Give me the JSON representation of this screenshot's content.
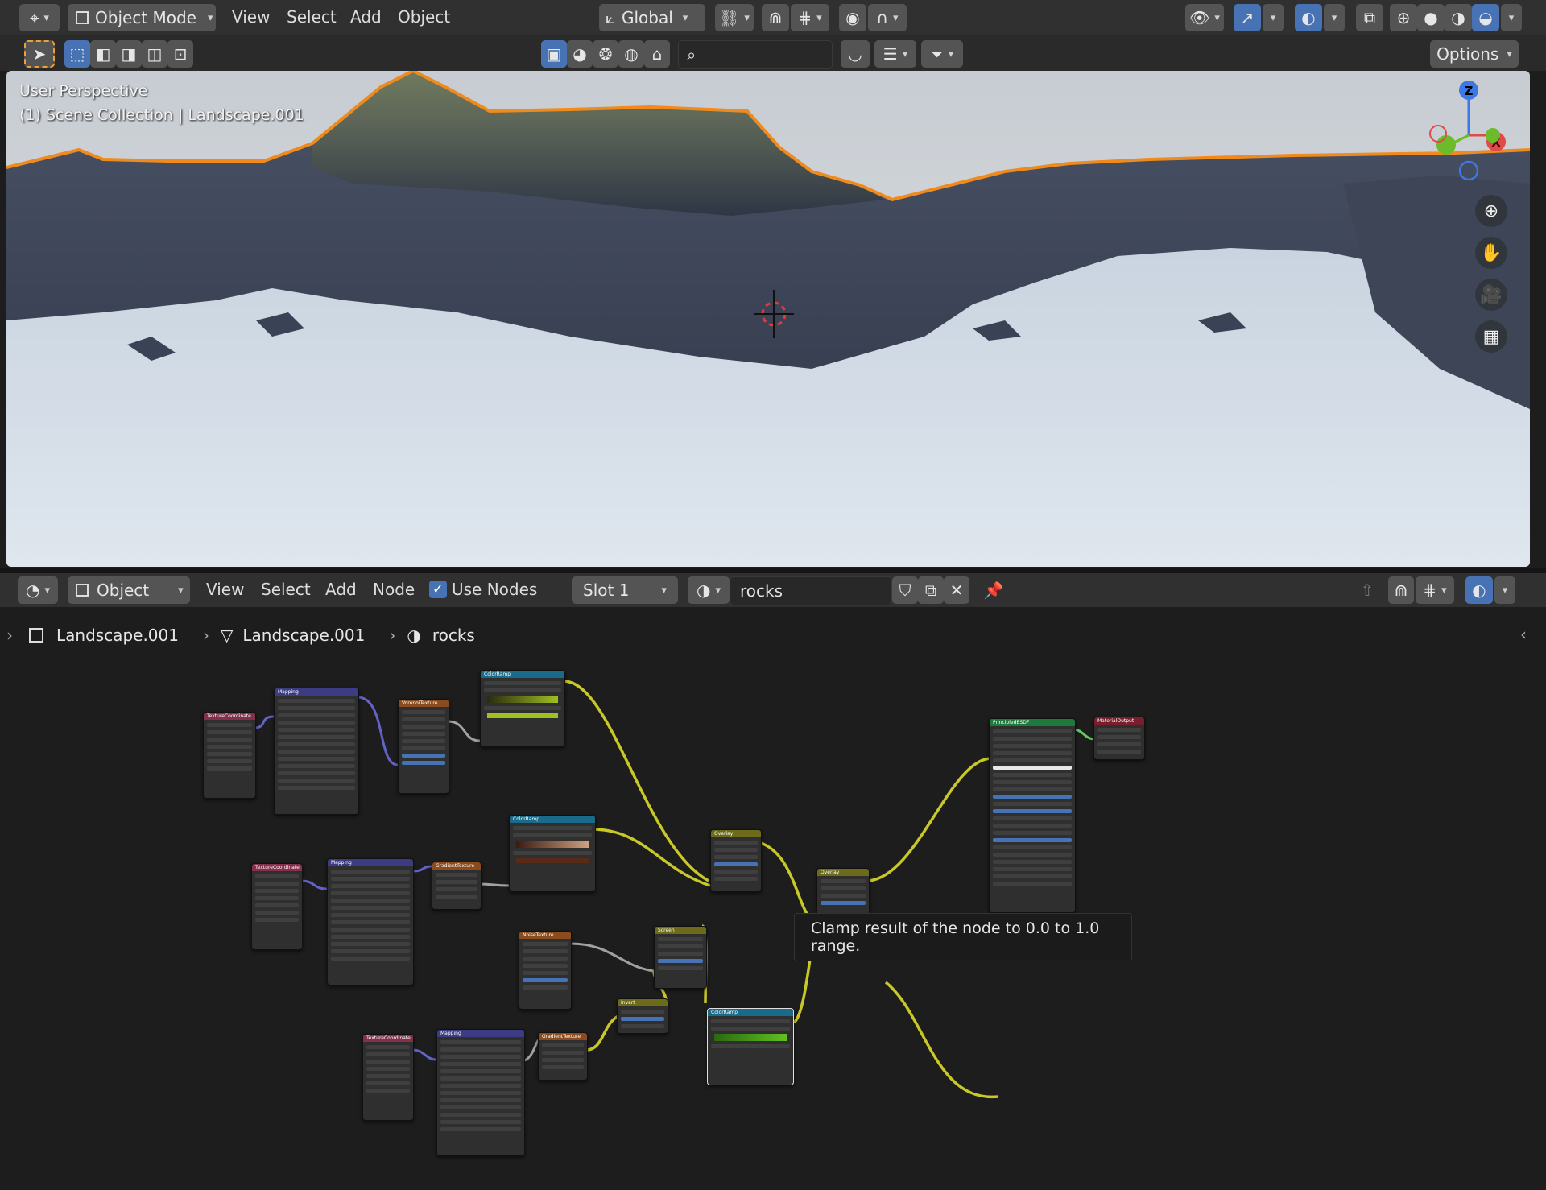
{
  "viewport_header": {
    "mode": "Object Mode",
    "menus": [
      "View",
      "Select",
      "Add",
      "Object"
    ],
    "orientation": "Global",
    "options": "Options"
  },
  "viewport": {
    "perspective": "User Perspective",
    "collection": "(1) Scene Collection | Landscape.001",
    "axis_z": "Z",
    "axis_x": "X"
  },
  "node_header": {
    "mode": "Object",
    "menus": [
      "View",
      "Select",
      "Add",
      "Node"
    ],
    "use_nodes": "Use Nodes",
    "use_nodes_checked": true,
    "slot": "Slot 1",
    "material": "rocks"
  },
  "breadcrumb": {
    "object": "Landscape.001",
    "mesh": "Landscape.001",
    "material": "rocks"
  },
  "tooltip": "Clamp result of the node to 0.0 to 1.0 range.",
  "colors": {
    "header": "#303030",
    "editor_bg": "#1d1d1d",
    "accent_blue": "#4772b3",
    "selection_orange": "#f08a1c",
    "link_yellow": "#c8c828",
    "link_purple": "#6363c7",
    "link_gray": "#a1a1a1",
    "link_green": "#63c763"
  },
  "nodes": [
    {
      "title": "TextureCoordinate",
      "color": "#83314a"
    },
    {
      "title": "Mapping",
      "color": "#3c3c83"
    },
    {
      "title": "VoronoiTexture",
      "color": "#8a4b1e"
    },
    {
      "title": "ColorRamp",
      "color": "#1a6b8a"
    },
    {
      "title": "TextureCoordinate",
      "color": "#83314a"
    },
    {
      "title": "Mapping",
      "color": "#3c3c83"
    },
    {
      "title": "GradientTexture",
      "color": "#8a4b1e"
    },
    {
      "title": "ColorRamp",
      "color": "#1a6b8a"
    },
    {
      "title": "Overlay",
      "color": "#6b6b1a"
    },
    {
      "title": "Overlay",
      "color": "#6b6b1a"
    },
    {
      "title": "NoiseTexture",
      "color": "#8a4b1e"
    },
    {
      "title": "Screen",
      "color": "#6b6b1a"
    },
    {
      "title": "TextureCoordinate",
      "color": "#83314a"
    },
    {
      "title": "Mapping",
      "color": "#3c3c83"
    },
    {
      "title": "GradientTexture",
      "color": "#8a4b1e"
    },
    {
      "title": "Invert",
      "color": "#6b6b1a"
    },
    {
      "title": "ColorRamp",
      "color": "#1a6b8a"
    },
    {
      "title": "PrincipledBSDF",
      "color": "#1e7a3c"
    },
    {
      "title": "MaterialOutput",
      "color": "#7a1e2e"
    }
  ]
}
